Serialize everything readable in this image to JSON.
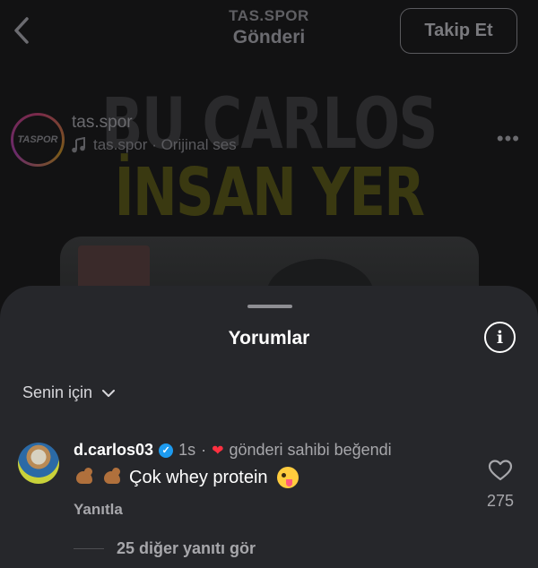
{
  "header": {
    "account": "TAS.SPOR",
    "title": "Gönderi",
    "follow_label": "Takip Et"
  },
  "post": {
    "thumbnail_line1": "BU CARLOS",
    "thumbnail_line2": "İNSAN YER",
    "author_name": "tas.spor",
    "avatar_text": "TASPOR",
    "audio_label": "tas.spor · Orijinal ses"
  },
  "sheet": {
    "title": "Yorumlar",
    "filter_label": "Senin için"
  },
  "comment": {
    "username": "d.carlos03",
    "time": "1s",
    "liked_by_author": "gönderi sahibi beğendi",
    "text": "Çok whey protein",
    "reply_label": "Yanıtla",
    "like_count": "275",
    "more_replies": "25 diğer yanıtı gör"
  },
  "colors": {
    "sheet_bg": "#26272b",
    "verified": "#1d9bf0",
    "heart": "#ff3040",
    "thumbnail_accent": "#3a3911"
  },
  "icons": [
    "back-arrow-icon",
    "music-note-icon",
    "more-dots-icon",
    "info-icon",
    "chevron-down-icon",
    "verified-badge-icon",
    "heart-filled-icon",
    "heart-outline-icon",
    "flexed-biceps-emoji",
    "zany-face-emoji"
  ]
}
